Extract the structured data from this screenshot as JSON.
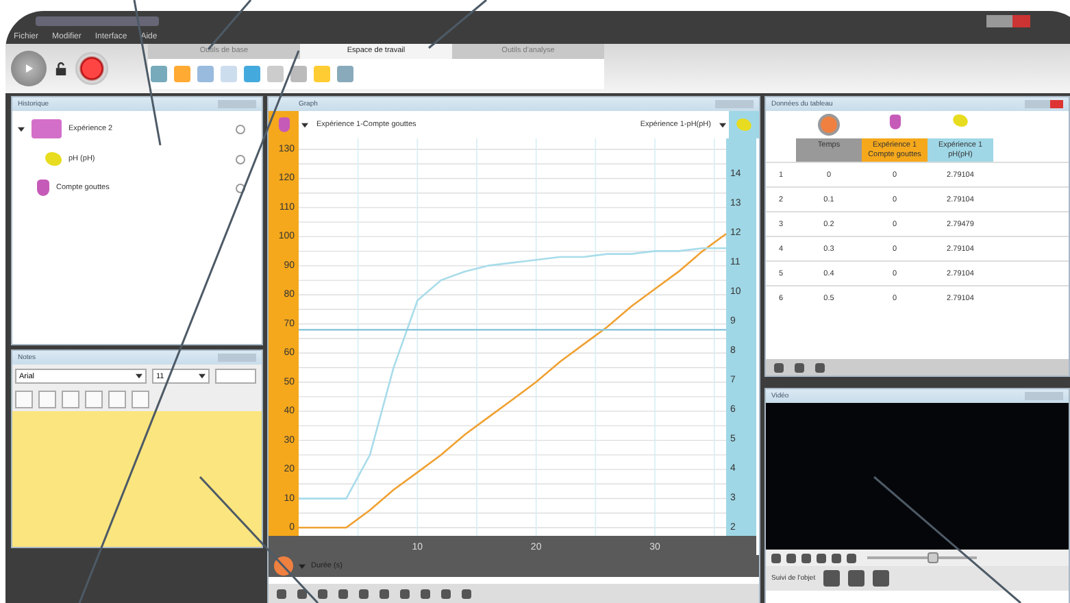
{
  "menu": [
    "Fichier",
    "Modifier",
    "Interface",
    "Aide"
  ],
  "tabs": [
    {
      "label": "Outils de base",
      "selected": false
    },
    {
      "label": "Espace de travail",
      "selected": true
    },
    {
      "label": "Outils d'analyse",
      "selected": false
    }
  ],
  "history": {
    "title": "Historique",
    "items": [
      {
        "label": "Expérience 2",
        "kind": "folder",
        "expanded": true
      },
      {
        "label": "pH (pH)",
        "kind": "probe"
      },
      {
        "label": "Compte gouttes",
        "kind": "dropper"
      }
    ]
  },
  "notes": {
    "title": "Notes",
    "font": "Arial",
    "size": "11"
  },
  "graph": {
    "title": "Graph",
    "chart_data": {
      "type": "line",
      "xlabel": "Durée (s)",
      "x": [
        0,
        2,
        4,
        6,
        8,
        10,
        12,
        14,
        16,
        18,
        20,
        22,
        24,
        26,
        28,
        30,
        32,
        34,
        36
      ],
      "xlim": [
        0,
        36
      ],
      "ylim": [
        0,
        130
      ],
      "y2lim": [
        2,
        14
      ],
      "xticks": [
        10,
        20,
        30
      ],
      "yticks": [
        0,
        10,
        20,
        30,
        40,
        50,
        60,
        70,
        80,
        90,
        100,
        110,
        120,
        130
      ],
      "y2ticks": [
        2,
        3,
        4,
        5,
        6,
        7,
        8,
        9,
        10,
        11,
        12,
        13,
        14
      ],
      "series": [
        {
          "name": "Expérience 1-Compte gouttes",
          "color": "#f0a030",
          "values": [
            0,
            0,
            0,
            6,
            13,
            19,
            25,
            32,
            38,
            44,
            50,
            57,
            63,
            69,
            76,
            82,
            88,
            95,
            101
          ]
        },
        {
          "name": "Expérience 1-pH(pH)",
          "color": "#a8dcea",
          "axis": "y2",
          "values": [
            3,
            3,
            3,
            4.5,
            7.5,
            9.8,
            10.5,
            10.8,
            11,
            11.1,
            11.2,
            11.3,
            11.3,
            11.4,
            11.4,
            11.5,
            11.5,
            11.6,
            11.6
          ]
        },
        {
          "color": "#8cc8dc",
          "values": [
            68,
            68,
            68,
            68,
            68,
            68,
            68,
            68,
            68,
            68,
            68,
            68,
            68,
            68,
            68,
            68,
            68,
            68,
            68
          ]
        }
      ],
      "grid": true
    }
  },
  "table": {
    "title": "Données du tableau",
    "columns": [
      "Temps",
      "Expérience 1 Compte gouttes",
      "Expérience 1 pH(pH)"
    ],
    "rows": [
      {
        "number": "1",
        "cells": [
          "0",
          "0",
          "2.79104"
        ]
      },
      {
        "number": "2",
        "cells": [
          "0.1",
          "0",
          "2.79104"
        ]
      },
      {
        "number": "3",
        "cells": [
          "0.2",
          "0",
          "2.79479"
        ]
      },
      {
        "number": "4",
        "cells": [
          "0.3",
          "0",
          "2.79104"
        ]
      },
      {
        "number": "5",
        "cells": [
          "0.4",
          "0",
          "2.79104"
        ]
      },
      {
        "number": "6",
        "cells": [
          "0.5",
          "0",
          "2.79104"
        ]
      }
    ]
  },
  "video": {
    "title": "Vidéo",
    "slider": {
      "level": 0.6
    },
    "tracking_label": "Suivi de l'objet"
  }
}
